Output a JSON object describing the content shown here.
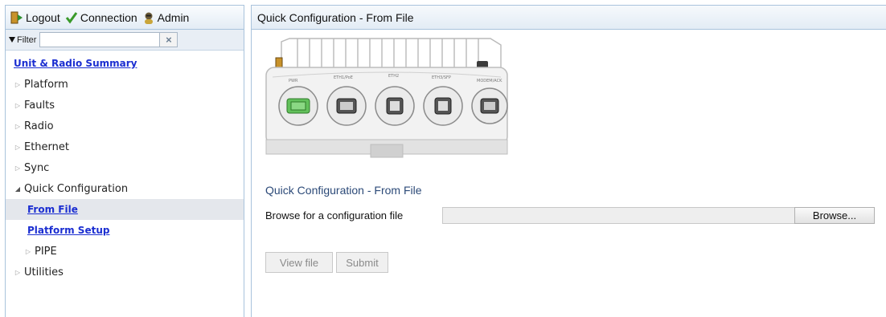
{
  "topbar": {
    "logout": "Logout",
    "connection": "Connection",
    "admin": "Admin"
  },
  "filter": {
    "label": "Filter",
    "value": "",
    "clear": "×"
  },
  "nav": {
    "summary": "Unit & Radio Summary",
    "platform": "Platform",
    "faults": "Faults",
    "radio": "Radio",
    "ethernet": "Ethernet",
    "sync": "Sync",
    "quick_config": "Quick Configuration",
    "from_file": "From File",
    "platform_setup": "Platform Setup",
    "pipe": "PIPE",
    "utilities": "Utilities"
  },
  "main": {
    "header": "Quick Configuration - From File",
    "section_title": "Quick Configuration - From File",
    "browse_label": "Browse for a configuration file",
    "browse_value": "",
    "browse_button": "Browse...",
    "view_button": "View file",
    "submit_button": "Submit"
  },
  "device": {
    "port_labels": [
      "PWR",
      "ETH1/PoE",
      "ETH2",
      "ETH3/SFP",
      "MODEM/ACK"
    ],
    "highlight_port": "PWR"
  },
  "colors": {
    "link": "#1b2ed1",
    "border": "#a9c3dc",
    "selected_row": "#e4e7ec",
    "section_title": "#2c4a78",
    "port_highlight": "#62c05b"
  }
}
